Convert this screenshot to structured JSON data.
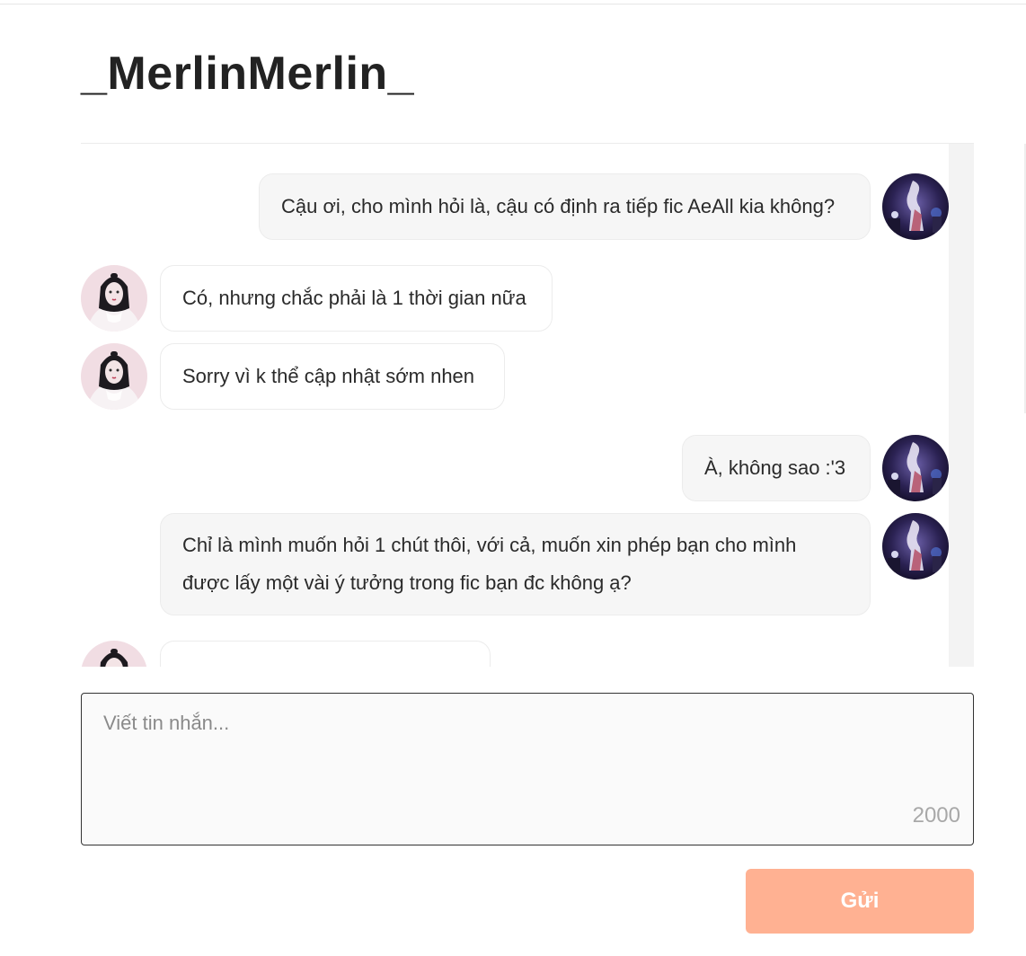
{
  "header": {
    "title": "_MerlinMerlin_"
  },
  "messages": [
    {
      "sender": "me",
      "text": "Cậu ơi, cho mình hỏi là, cậu có định ra tiếp fic AeAll kia không?"
    },
    {
      "sender": "them",
      "text": "Có, nhưng chắc phải là 1 thời gian nữa"
    },
    {
      "sender": "them",
      "text": "Sorry vì k thể cập nhật sớm nhen"
    },
    {
      "sender": "me",
      "text": "À, không sao :'3"
    },
    {
      "sender": "me",
      "text": "Chỉ là mình muốn hỏi 1 chút thôi, với cả, muốn xin phép bạn cho mình được lấy một vài ý tưởng trong fic bạn đc không ạ?"
    }
  ],
  "composer": {
    "placeholder": "Viết tin nhắn...",
    "char_limit": "2000"
  },
  "send_button": {
    "label": "Gửi"
  },
  "colors": {
    "send_button_bg": "#ffb192",
    "bubble_mine_bg": "#f6f6f6",
    "composer_border": "#333333"
  }
}
